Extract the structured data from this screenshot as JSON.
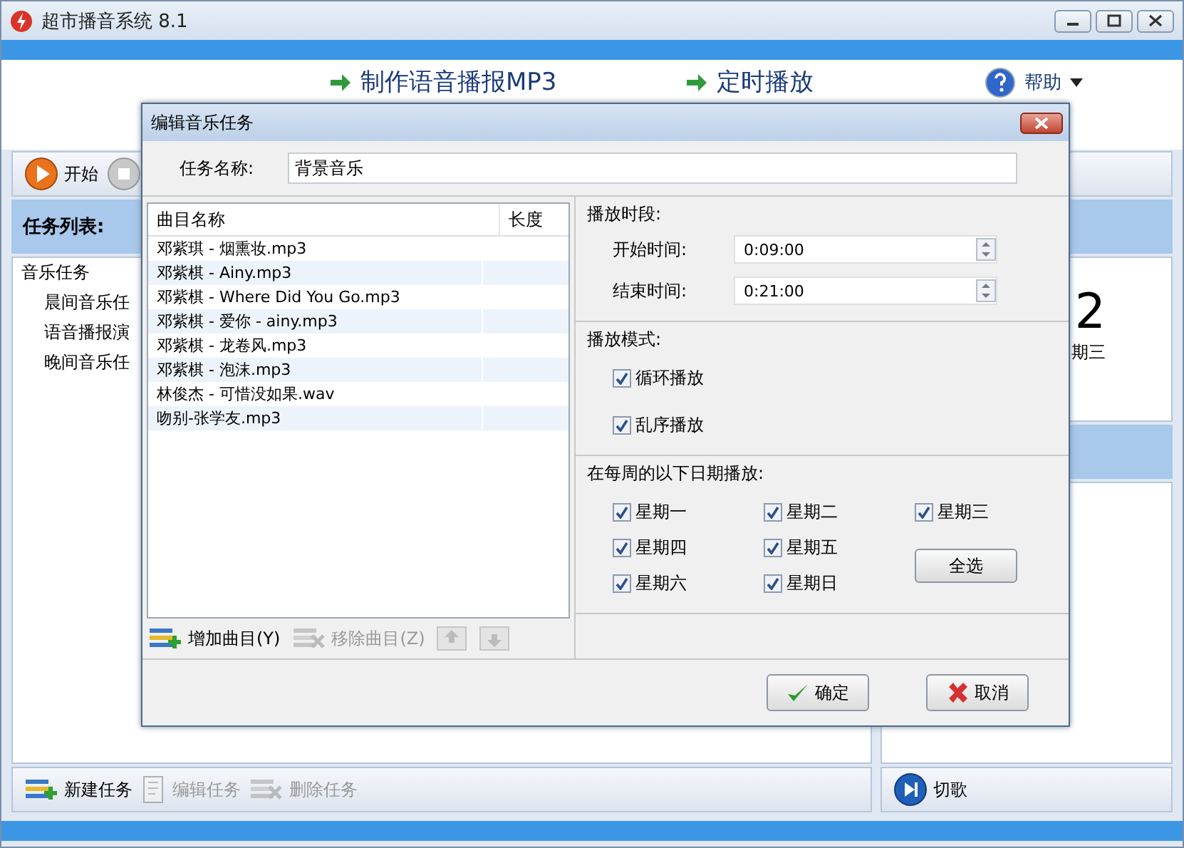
{
  "window": {
    "title": "超市播音系统 8.1"
  },
  "top_links": [
    {
      "label": "制作语音播报MP3",
      "kind": "arrow"
    },
    {
      "label": "定时播放",
      "kind": "arrow"
    },
    {
      "label": "帮助",
      "kind": "help"
    }
  ],
  "toolbar": [
    {
      "label": "开始",
      "kind": "play"
    },
    {
      "kind": "stop"
    }
  ],
  "task_panel": {
    "title": "任务列表:",
    "tree": [
      {
        "label": "音乐任务",
        "children": [
          {
            "label": "晨间音乐任"
          },
          {
            "label": "语音播报演"
          },
          {
            "label": "晚间音乐任"
          }
        ]
      }
    ]
  },
  "task_actions": [
    {
      "label": "新建任务",
      "kind": "add",
      "disabled": false
    },
    {
      "label": "编辑任务",
      "kind": "edit",
      "disabled": true
    },
    {
      "label": "删除任务",
      "kind": "remove",
      "disabled": true
    }
  ],
  "clock_panel": {
    "time": "2",
    "weekday": "期三"
  },
  "player_actions": [
    {
      "label": "切歌",
      "kind": "next"
    }
  ],
  "dialog": {
    "title": "编辑音乐任务",
    "name_label": "任务名称:",
    "name_value": "背景音乐",
    "columns": [
      "曲目名称",
      "长度"
    ],
    "tracks": [
      {
        "name": "邓紫琪 - 烟熏妆.mp3"
      },
      {
        "name": "邓紫棋 - Ainy.mp3"
      },
      {
        "name": "邓紫棋 - Where Did You Go.mp3"
      },
      {
        "name": "邓紫棋 - 爱你 - ainy.mp3"
      },
      {
        "name": "邓紫棋 - 龙卷风.mp3"
      },
      {
        "name": "邓紫棋 - 泡沫.mp3"
      },
      {
        "name": "林俊杰 - 可惜没如果.wav"
      },
      {
        "name": "吻别-张学友.mp3"
      }
    ],
    "track_actions": [
      {
        "label": "增加曲目(Y)",
        "kind": "add",
        "disabled": false
      },
      {
        "label": "移除曲目(Z)",
        "kind": "remove",
        "disabled": true
      },
      {
        "kind": "up",
        "disabled": true
      },
      {
        "kind": "down",
        "disabled": true
      }
    ],
    "period": {
      "title": "播放时段:",
      "fields": [
        {
          "label": "开始时间:",
          "value": "0:09:00"
        },
        {
          "label": "结束时间:",
          "value": "0:21:00"
        }
      ]
    },
    "mode": {
      "title": "播放模式:",
      "options": [
        {
          "label": "循环播放",
          "checked": true
        },
        {
          "label": "乱序播放",
          "checked": true
        }
      ]
    },
    "days": {
      "title": "在每周的以下日期播放:",
      "items": [
        {
          "label": "星期一",
          "checked": true
        },
        {
          "label": "星期二",
          "checked": true
        },
        {
          "label": "星期三",
          "checked": true
        },
        {
          "label": "星期四",
          "checked": true
        },
        {
          "label": "星期五",
          "checked": true
        },
        {
          "label": "星期六",
          "checked": true
        },
        {
          "label": "星期日",
          "checked": true
        }
      ],
      "select_all": "全选"
    },
    "buttons": [
      {
        "label": "确定",
        "kind": "ok"
      },
      {
        "label": "取消",
        "kind": "cancel"
      }
    ]
  }
}
